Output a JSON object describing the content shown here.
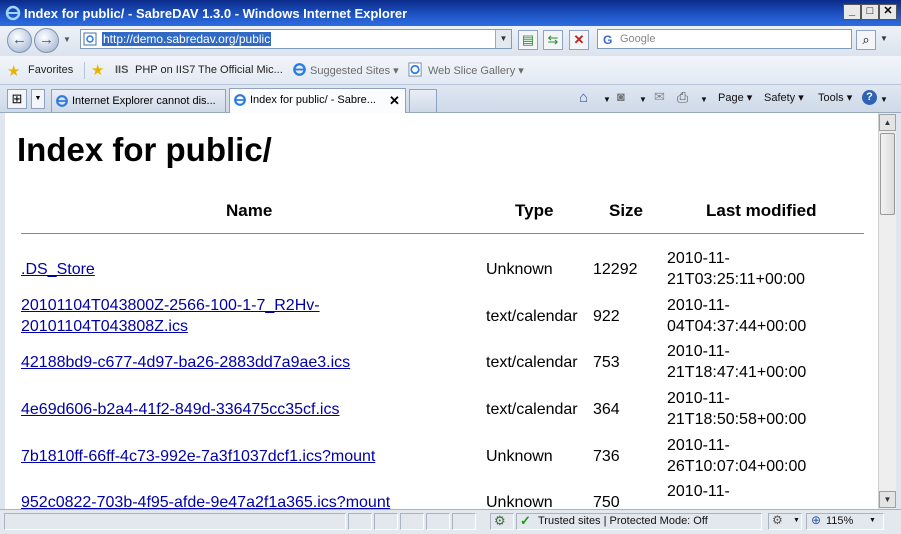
{
  "window": {
    "title": "Index for public/ - SabreDAV 1.3.0 - Windows Internet Explorer",
    "controls": {
      "minimize": "_",
      "maximize": "□",
      "close": "✕"
    }
  },
  "address_bar": {
    "url": "http://demo.sabredav.org/public"
  },
  "search": {
    "placeholder": "Google"
  },
  "favorites_bar": {
    "favorites_label": "Favorites",
    "items": [
      {
        "label": "PHP on IIS7",
        "icon": "iis-icon"
      },
      {
        "label": "The Official Mic...",
        "icon": "none"
      },
      {
        "label": "Suggested Sites ▾",
        "icon": "ie-icon"
      },
      {
        "label": "Web Slice Gallery ▾",
        "icon": "ie-page-icon"
      }
    ]
  },
  "tabs": [
    {
      "label": "Internet Explorer cannot dis...",
      "active": false
    },
    {
      "label": "Index for public/ - Sabre...",
      "active": true
    }
  ],
  "command_bar": {
    "page": "Page ▾",
    "safety": "Safety ▾",
    "tools": "Tools ▾",
    "help": "?"
  },
  "page": {
    "heading": "Index for public/",
    "columns": {
      "name": "Name",
      "type": "Type",
      "size": "Size",
      "modified": "Last modified"
    },
    "rows": [
      {
        "name_lines": [
          ".DS_Store"
        ],
        "type": "Unknown",
        "size": "12292",
        "modified_lines": [
          "2010-11-",
          "21T03:25:11+00:00"
        ]
      },
      {
        "name_lines": [
          "20101104T043800Z-2566-100-1-7_R2Hv-",
          "20101104T043808Z.ics"
        ],
        "type": "text/calendar",
        "size": "922",
        "modified_lines": [
          "2010-11-",
          "04T04:37:44+00:00"
        ]
      },
      {
        "name_lines": [
          "42188bd9-c677-4d97-ba26-2883dd7a9ae3.ics"
        ],
        "type": "text/calendar",
        "size": "753",
        "modified_lines": [
          "2010-11-",
          "21T18:47:41+00:00"
        ]
      },
      {
        "name_lines": [
          "4e69d606-b2a4-41f2-849d-336475cc35cf.ics"
        ],
        "type": "text/calendar",
        "size": "364",
        "modified_lines": [
          "2010-11-",
          "21T18:50:58+00:00"
        ]
      },
      {
        "name_lines": [
          "7b1810ff-66ff-4c73-992e-7a3f1037dcf1.ics?mount"
        ],
        "type": "Unknown",
        "size": "736",
        "modified_lines": [
          "2010-11-",
          "26T10:07:04+00:00"
        ]
      },
      {
        "name_lines": [
          "952c0822-703b-4f95-afde-9e47a2f1a365.ics?mount"
        ],
        "type": "Unknown",
        "size": "750",
        "modified_lines": [
          "2010-11-"
        ]
      }
    ]
  },
  "status_bar": {
    "zone": "Trusted sites | Protected Mode: Off",
    "zoom": "115%"
  },
  "colors": {
    "link": "#0000aa",
    "titlebar": "#1f56c7",
    "url_highlight": "#316ac5"
  }
}
